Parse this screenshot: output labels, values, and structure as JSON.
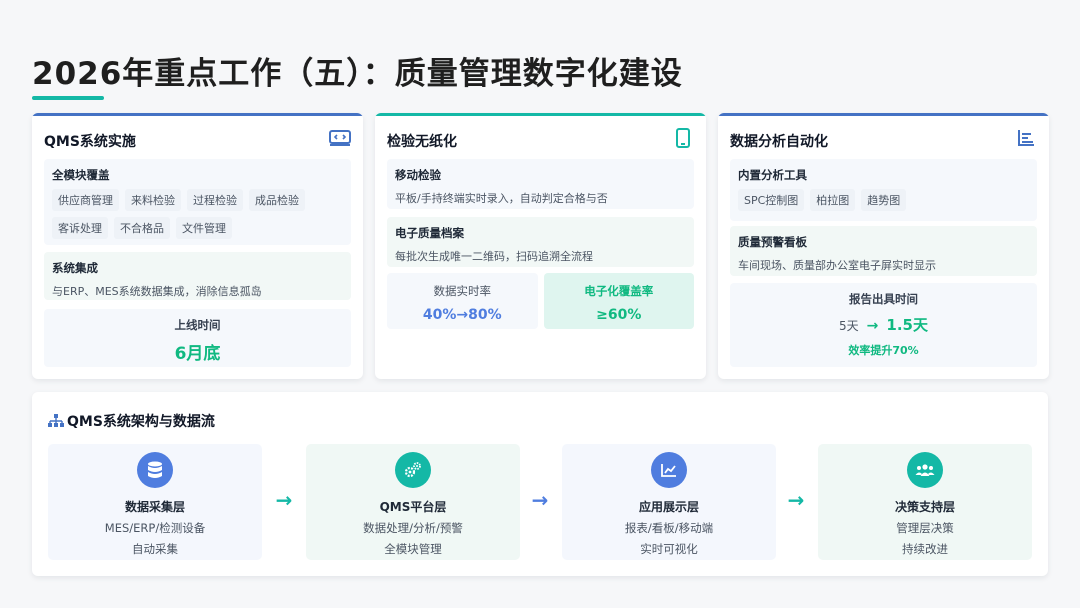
{
  "page": {
    "title": "2026年重点工作（五）：质量管理数字化建设"
  },
  "colors": {
    "blue": "#4472c4",
    "teal": "#14b8a6",
    "green": "#10b981",
    "blue_value": "#4f7ddf"
  },
  "cards": {
    "qms": {
      "title": "QMS系统实施",
      "icon": "code-window-icon",
      "coverage_title": "全模块覆盖",
      "modules": [
        "供应商管理",
        "来料检验",
        "过程检验",
        "成品检验",
        "客诉处理",
        "不合格品",
        "文件管理"
      ],
      "integration_title": "系统集成",
      "integration_text": "与ERP、MES系统数据集成，消除信息孤岛",
      "launch_label": "上线时间",
      "launch_value": "6月底"
    },
    "paperless": {
      "title": "检验无纸化",
      "icon": "tablet-icon",
      "mobile_title": "移动检验",
      "mobile_text": "平板/手持终端实时录入，自动判定合格与否",
      "archive_title": "电子质量档案",
      "archive_text": "每批次生成唯一二维码，扫码追溯全流程",
      "realtime_label": "数据实时率",
      "realtime_value": "40%→80%",
      "coverage_label": "电子化覆盖率",
      "coverage_value": "≥60%"
    },
    "analytics": {
      "title": "数据分析自动化",
      "icon": "bar-chart-icon",
      "tools_title": "内置分析工具",
      "tools": [
        "SPC控制图",
        "柏拉图",
        "趋势图"
      ],
      "board_title": "质量预警看板",
      "board_text": "车间现场、质量部办公室电子屏实时显示",
      "report_label": "报告出具时间",
      "report_from": "5天",
      "report_arrow": "→",
      "report_to": "1.5天",
      "report_gain": "效率提升70%"
    }
  },
  "architecture": {
    "title": "QMS系统架构与数据流",
    "layers": [
      {
        "title": "数据采集层",
        "line1": "MES/ERP/检测设备",
        "line2": "自动采集",
        "icon": "database-icon"
      },
      {
        "title": "QMS平台层",
        "line1": "数据处理/分析/预警",
        "line2": "全模块管理",
        "icon": "gears-icon"
      },
      {
        "title": "应用展示层",
        "line1": "报表/看板/移动端",
        "line2": "实时可视化",
        "icon": "line-chart-icon"
      },
      {
        "title": "决策支持层",
        "line1": "管理层决策",
        "line2": "持续改进",
        "icon": "users-icon"
      }
    ],
    "arrow": "→"
  }
}
